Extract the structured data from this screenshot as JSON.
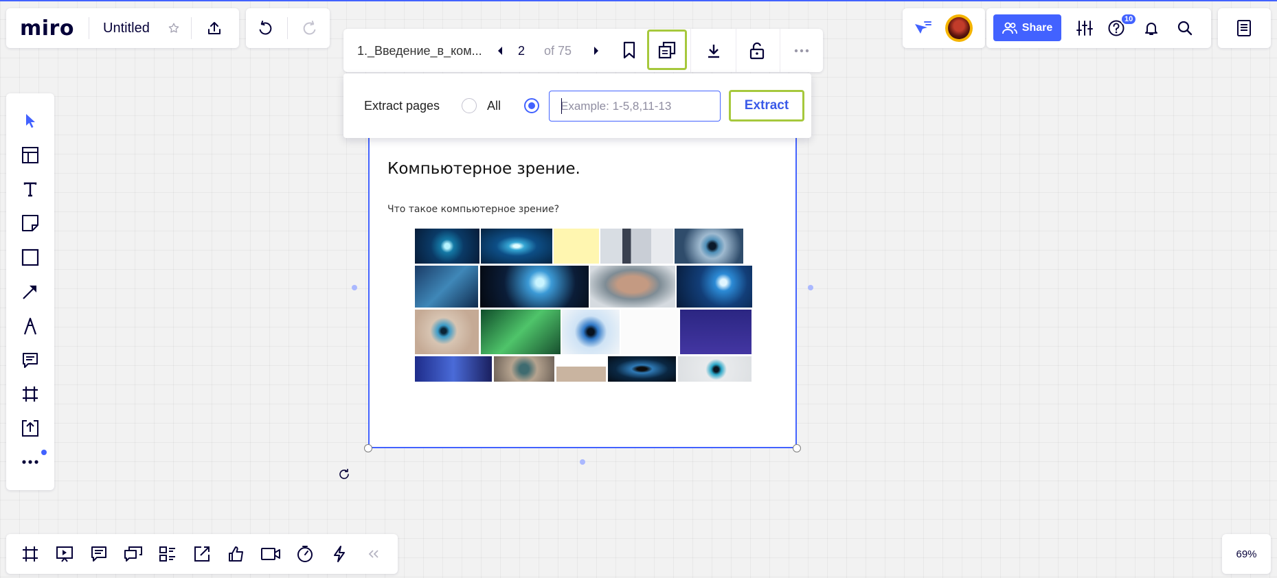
{
  "app": {
    "logo": "miro",
    "board_title": "Untitled"
  },
  "share": {
    "label": "Share",
    "help_badge": "10"
  },
  "pdf_toolbar": {
    "file_name": "1._Введение_в_ком...",
    "page": "2",
    "of_total": "of 75"
  },
  "extract": {
    "label": "Extract pages",
    "option_all": "All",
    "input_placeholder": "Example: 1-5,8,11-13",
    "button": "Extract"
  },
  "slide": {
    "title": "Компьютерное зрение.",
    "subtitle": "Что такое компьютерное зрение?"
  },
  "zoom": "69%",
  "colors": {
    "accent": "#4262ff",
    "highlight": "#a6c83c"
  }
}
